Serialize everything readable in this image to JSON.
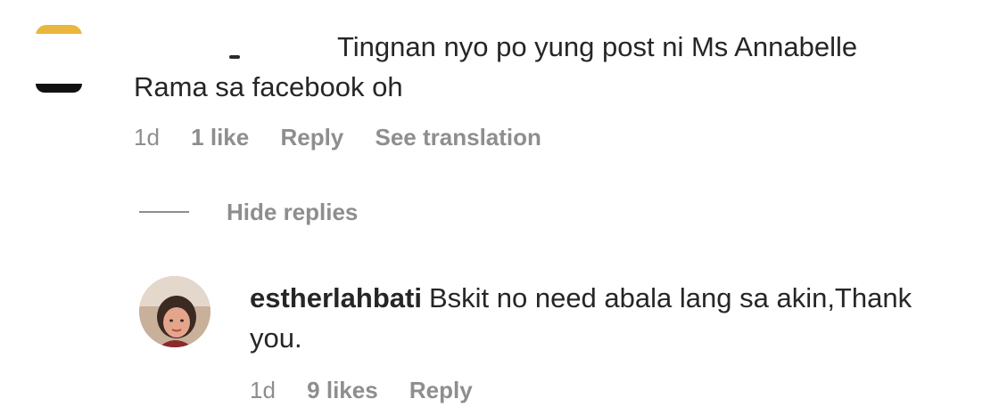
{
  "comment": {
    "text": "Tingnan nyo po yung post ni Ms Annabelle Rama sa facebook oh",
    "time": "1d",
    "likes": "1 like",
    "reply_label": "Reply",
    "translate_label": "See translation"
  },
  "replies_toggle": {
    "label": "Hide replies"
  },
  "reply": {
    "username": "estherlahbati",
    "text": "Bskit no need abala lang sa akin,Thank you.",
    "time": "1d",
    "likes": "9 likes",
    "reply_label": "Reply"
  },
  "colors": {
    "text": "#262626",
    "secondary": "#8e8e8e",
    "avatar_accent": "#e9b73d"
  }
}
